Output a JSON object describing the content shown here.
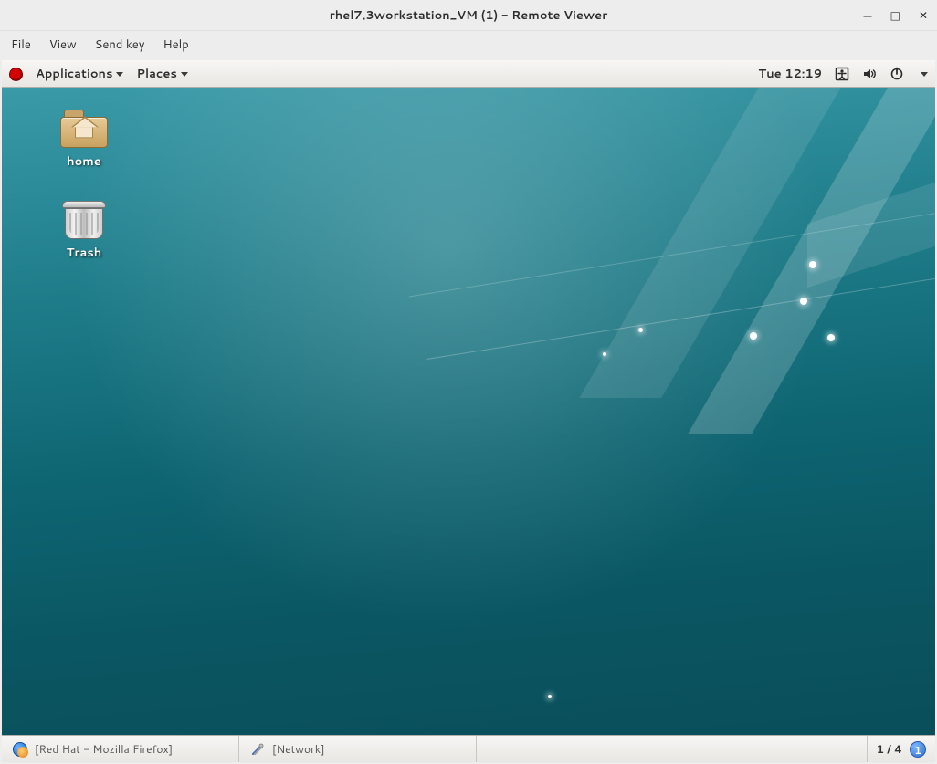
{
  "outerWindow": {
    "title": "rhel7.3workstation_VM (1) - Remote Viewer",
    "menus": [
      "File",
      "View",
      "Send key",
      "Help"
    ]
  },
  "gnomeTopBar": {
    "applications": "Applications",
    "places": "Places",
    "clock": "Tue 12:19"
  },
  "desktopIcons": {
    "home": "home",
    "trash": "Trash"
  },
  "taskbar": {
    "firefox": "[Red Hat - Mozilla Firefox]",
    "network": "[Network]",
    "workspace": "1 / 4",
    "workspaceBadge": "1"
  }
}
